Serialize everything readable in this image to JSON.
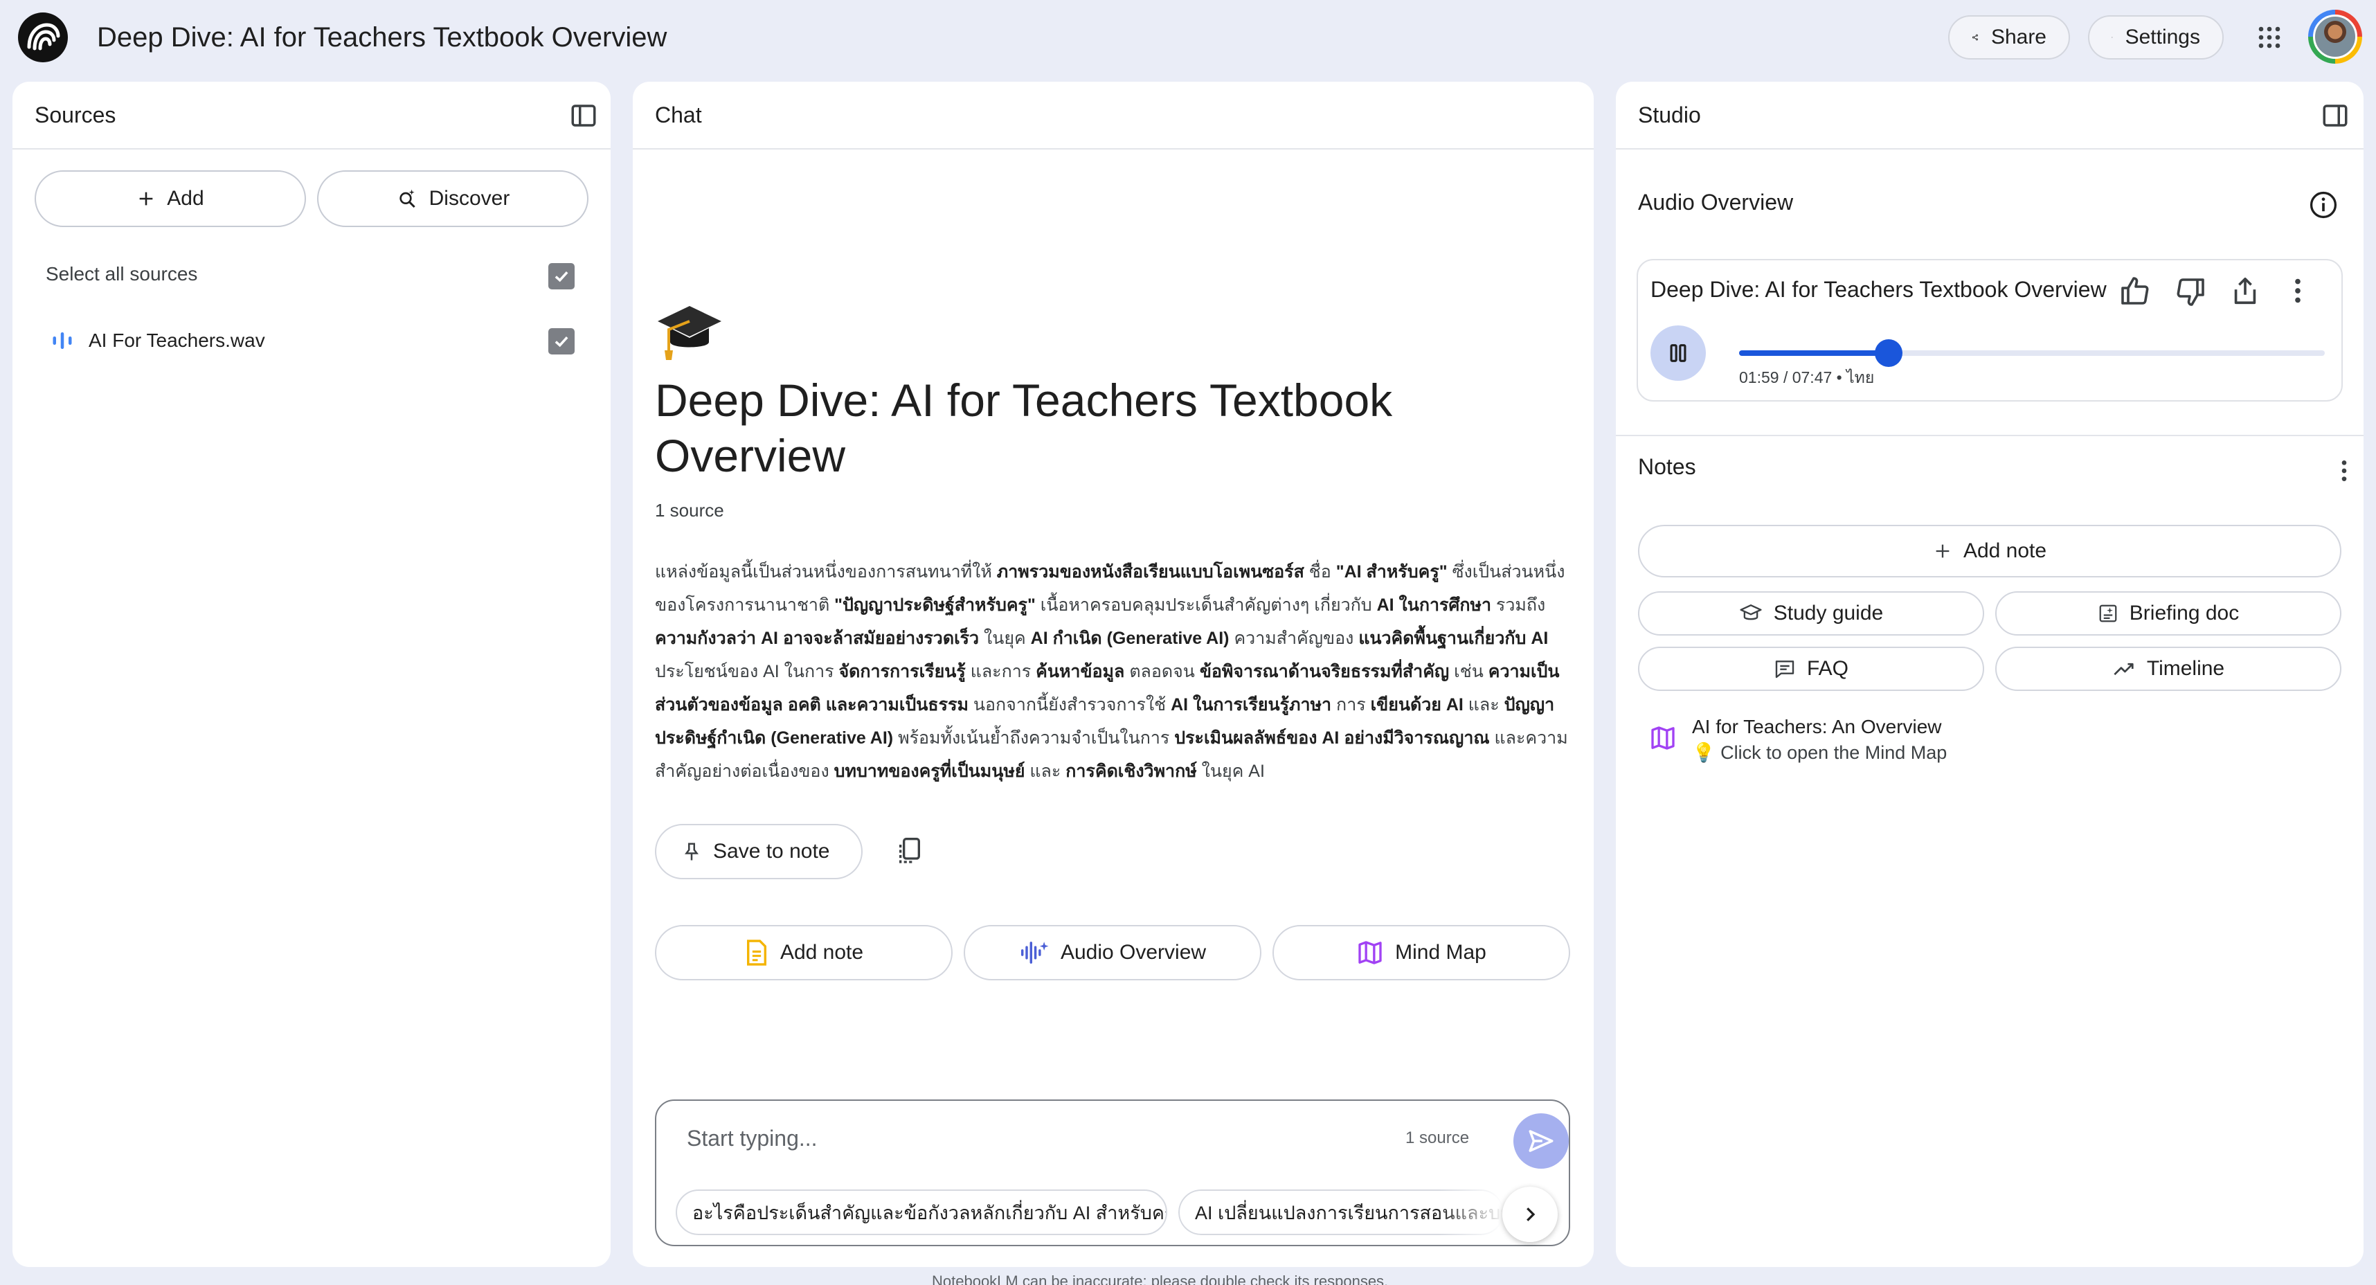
{
  "app": {
    "title": "Deep Dive: AI for Teachers Textbook Overview",
    "share_label": "Share",
    "settings_label": "Settings"
  },
  "sources": {
    "title": "Sources",
    "add_label": "Add",
    "discover_label": "Discover",
    "select_all_label": "Select all sources",
    "items": [
      {
        "name": "AI For Teachers.wav",
        "checked": true
      }
    ]
  },
  "chat": {
    "title": "Chat",
    "emoji": "🎓",
    "heading": "Deep Dive: AI for Teachers Textbook Overview",
    "source_count": "1 source",
    "summary": [
      {
        "t": "แหล่งข้อมูลนี้เป็นส่วนหนึ่งของการสนทนาที่ให้ ",
        "b": false
      },
      {
        "t": "ภาพรวมของหนังสือเรียนแบบโอเพนซอร์ส",
        "b": true
      },
      {
        "t": " ชื่อ ",
        "b": false
      },
      {
        "t": "\"AI สำหรับครู\"",
        "b": true
      },
      {
        "t": " ซึ่งเป็นส่วนหนึ่งของโครงการนานาชาติ ",
        "b": false
      },
      {
        "t": "\"ปัญญาประดิษฐ์สำหรับครู\"",
        "b": true
      },
      {
        "t": " เนื้อหาครอบคลุมประเด็นสำคัญต่างๆ เกี่ยวกับ ",
        "b": false
      },
      {
        "t": "AI ในการศึกษา",
        "b": true
      },
      {
        "t": " รวมถึง ",
        "b": false
      },
      {
        "t": "ความกังวลว่า AI อาจจะล้าสมัยอย่างรวดเร็ว",
        "b": true
      },
      {
        "t": " ในยุค ",
        "b": false
      },
      {
        "t": "AI กำเนิด (Generative AI)",
        "b": true
      },
      {
        "t": " ความสำคัญของ ",
        "b": false
      },
      {
        "t": "แนวคิดพื้นฐานเกี่ยวกับ AI",
        "b": true
      },
      {
        "t": " ประโยชน์ของ AI ในการ ",
        "b": false
      },
      {
        "t": "จัดการการเรียนรู้",
        "b": true
      },
      {
        "t": " และการ ",
        "b": false
      },
      {
        "t": "ค้นหาข้อมูล",
        "b": true
      },
      {
        "t": " ตลอดจน ",
        "b": false
      },
      {
        "t": "ข้อพิจารณาด้านจริยธรรมที่สำคัญ",
        "b": true
      },
      {
        "t": " เช่น ",
        "b": false
      },
      {
        "t": "ความเป็นส่วนตัวของข้อมูล อคติ และความเป็นธรรม",
        "b": true
      },
      {
        "t": " นอกจากนี้ยังสำรวจการใช้ ",
        "b": false
      },
      {
        "t": "AI ในการเรียนรู้ภาษา",
        "b": true
      },
      {
        "t": " การ ",
        "b": false
      },
      {
        "t": "เขียนด้วย AI",
        "b": true
      },
      {
        "t": " และ ",
        "b": false
      },
      {
        "t": "ปัญญาประดิษฐ์กำเนิด (Generative AI)",
        "b": true
      },
      {
        "t": " พร้อมทั้งเน้นย้ำถึงความจำเป็นในการ ",
        "b": false
      },
      {
        "t": "ประเมินผลลัพธ์ของ AI อย่างมีวิจารณญาณ",
        "b": true
      },
      {
        "t": " และความสำคัญอย่างต่อเนื่องของ ",
        "b": false
      },
      {
        "t": "บทบาทของครูที่เป็นมนุษย์",
        "b": true
      },
      {
        "t": " และ ",
        "b": false
      },
      {
        "t": "การคิดเชิงวิพากษ์",
        "b": true
      },
      {
        "t": " ในยุค AI",
        "b": false
      }
    ],
    "save_to_note_label": "Save to note",
    "actions": {
      "add_note": "Add note",
      "audio_overview": "Audio Overview",
      "mind_map": "Mind Map"
    },
    "composer": {
      "placeholder": "Start typing...",
      "source_count": "1 source",
      "suggestions": [
        "อะไรคือประเด็นสำคัญและข้อกังวลหลักเกี่ยวกับ AI สำหรับครู",
        "AI เปลี่ยนแปลงการเรียนการสอนและบทบาทของครูอย่างไร"
      ]
    },
    "disclaimer": "NotebookLM can be inaccurate; please double check its responses."
  },
  "studio": {
    "title": "Studio",
    "audio_overview_label": "Audio Overview",
    "audio": {
      "title": "Deep Dive: AI for Teachers Textbook Overview",
      "time": "01:59 / 07:47 • ไทย",
      "progress": 0.255
    },
    "notes_label": "Notes",
    "add_note_label": "Add note",
    "note_buttons": {
      "study_guide": "Study guide",
      "briefing_doc": "Briefing doc",
      "faq": "FAQ",
      "timeline": "Timeline"
    },
    "mind_map_note": {
      "title": "AI for Teachers: An Overview",
      "subtitle": "💡 Click to open the Mind Map"
    }
  },
  "colors": {
    "background": "#eaedf7",
    "accent": "#1a56db",
    "send_button": "#a5b0ef"
  }
}
